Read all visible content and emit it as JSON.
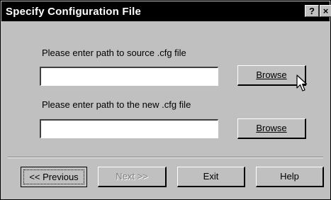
{
  "window": {
    "title": "Specify Configuration File"
  },
  "titlebar_buttons": {
    "help": "?",
    "close": "×"
  },
  "source": {
    "prompt": "Please enter path to source .cfg file",
    "value": "",
    "browse_label": "Browse"
  },
  "target": {
    "prompt": "Please enter path to the new .cfg file",
    "value": "",
    "browse_label": "Browse"
  },
  "footer": {
    "previous": "<< Previous",
    "next": "Next >>",
    "exit": "Exit",
    "help": "Help"
  },
  "icons": {
    "cursor": "mouse-pointer-icon"
  }
}
